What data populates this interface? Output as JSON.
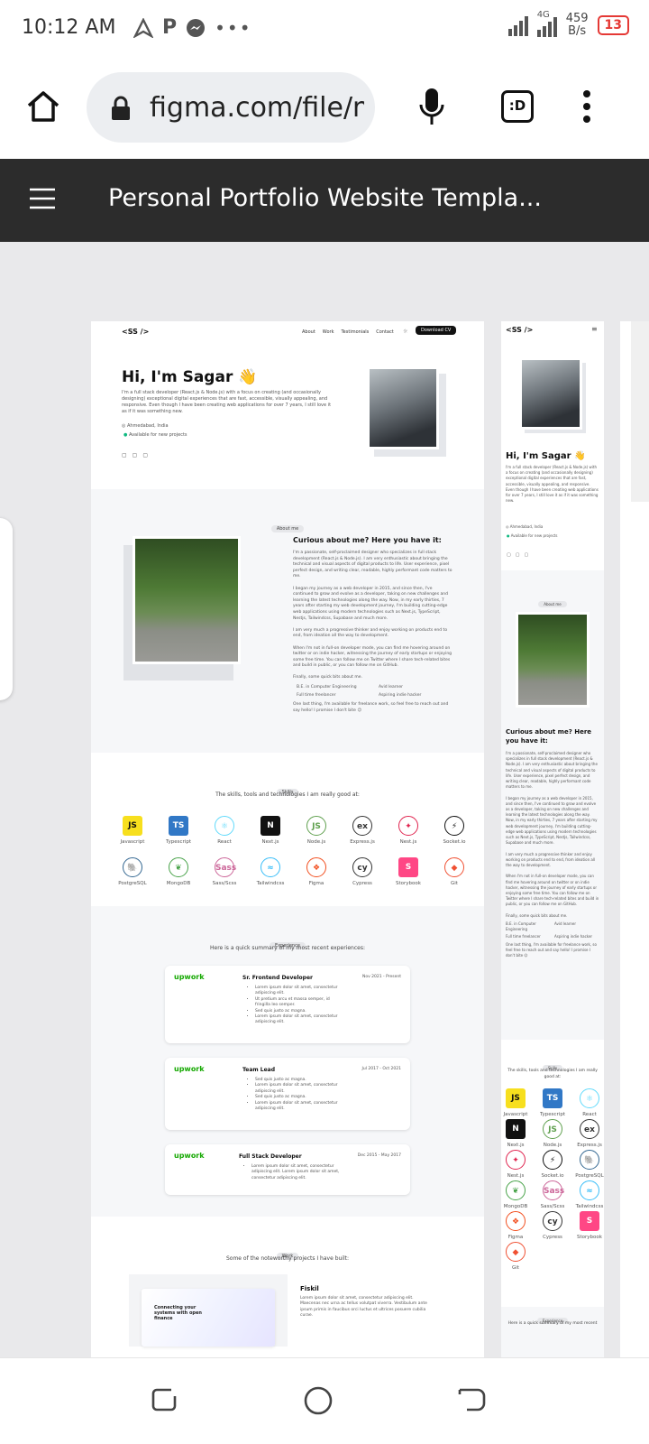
{
  "status_bar": {
    "time": "10:12 AM",
    "network": "4G",
    "speed_value": "459",
    "speed_unit": "B/s",
    "battery": "13"
  },
  "browser": {
    "url": "figma.com/file/m",
    "tab_label": ":D"
  },
  "figma": {
    "file_title": "Personal Portfolio Website Templa..."
  },
  "desktop": {
    "logo": "<SS />",
    "nav": [
      "About",
      "Work",
      "Testimonials",
      "Contact"
    ],
    "download_cv": "Download CV",
    "hero_title": "Hi, I'm Sagar 👋",
    "hero_text": "I'm a full stack developer (React.js & Node.js) with a focus on creating (and occasionally designing) exceptional digital experiences that are fast, accessible, visually appealing, and responsive. Even though I have been creating web applications for over 7 years, I still love it as if it was something new.",
    "location": "Ahmedabad, India",
    "availability": "Available for new projects",
    "about_chip": "About me",
    "about_title": "Curious about me? Here you have it:",
    "about_p1": "I'm a passionate, self-proclaimed designer who specializes in full stack development (React.js & Node.js). I am very enthusiastic about bringing the technical and visual aspects of digital products to life. User experience, pixel perfect design, and writing clear, readable, highly performant code matters to me.",
    "about_p2": "I began my journey as a web developer in 2015, and since then, I've continued to grow and evolve as a developer, taking on new challenges and learning the latest technologies along the way. Now, in my early thirties, 7 years after starting my web development journey, I'm building cutting-edge web applications using modern technologies such as Next.js, TypeScript, Nestjs, Tailwindcss, Supabase and much more.",
    "about_p3": "I am very much a progressive thinker and enjoy working on products end to end, from ideation all the way to development.",
    "about_p4": "When I'm not in full-on developer mode, you can find me hovering around on twitter or on indie hacker, witnessing the journey of early startups or enjoying some free time. You can follow me on Twitter where I share tech-related bites and build in public, or you can follow me on GitHub.",
    "about_p5": "Finally, some quick bits about me.",
    "bits": [
      "B.E. in Computer Engineering",
      "Avid learner",
      "Full time freelancer",
      "Aspiring indie hacker"
    ],
    "about_p6": "One last thing, I'm available for freelance work, so feel free to reach out and say hello! I promise I don't bite 😉",
    "skills_chip": "Skills",
    "skills_title": "The skills, tools and technologies I am really good at:",
    "skills": [
      "Javascript",
      "Typescript",
      "React",
      "Next.js",
      "Node.js",
      "Express.js",
      "Nest.js",
      "Socket.io",
      "PostgreSQL",
      "MongoDB",
      "Sass/Scss",
      "Tailwindcss",
      "Figma",
      "Cypress",
      "Storybook",
      "Git"
    ],
    "exp_chip": "Experience",
    "exp_title": "Here is a quick summary of my most recent experiences:",
    "jobs": [
      {
        "company": "upwork",
        "role": "Sr. Frontend Developer",
        "dates": "Nov 2021 - Present",
        "bullets": [
          "Lorem ipsum dolor sit amet, consectetur adipiscing elit.",
          "Ut pretium arcu et massa semper, id fringilla leo semper.",
          "Sed quis justo ac magna.",
          "Lorem ipsum dolor sit amet, consectetur adipiscing elit."
        ]
      },
      {
        "company": "upwork",
        "role": "Team Lead",
        "dates": "Jul 2017 - Oct 2021",
        "bullets": [
          "Sed quis justo ac magna.",
          "Lorem ipsum dolor sit amet, consectetur adipiscing elit.",
          "Sed quis justo ac magna.",
          "Lorem ipsum dolor sit amet, consectetur adipiscing elit."
        ]
      },
      {
        "company": "upwork",
        "role": "Full Stack Developer",
        "dates": "Dec 2015 - May 2017",
        "bullets": [
          "Lorem ipsum dolor sit amet, consectetur adipiscing elit. Lorem ipsum dolor sit amet, consectetur adipiscing elit."
        ]
      }
    ],
    "work_chip": "Work",
    "work_title": "Some of the noteworthy projects I have built:",
    "project_name": "Fiskil",
    "project_text": "Lorem ipsum dolor sit amet, consectetur adipiscing elit. Maecenas nec urna ac tellus volutpat viverra. Vestibulum ante ipsum primis in faucibus orci luctus et ultrices posuere cubilia curae.",
    "project_tagline": "Connecting your systems with open finance"
  },
  "mobile": {
    "logo": "<SS />",
    "hero_title": "Hi, I'm Sagar 👋",
    "about_chip": "About me",
    "about_title": "Curious about me? Here you have it:",
    "skills_chip": "Skills",
    "skills_title": "The skills, tools and technologies I am really good at:",
    "skills": [
      "Javascript",
      "Typescript",
      "React",
      "Next.js",
      "Node.js",
      "Express.js",
      "Nest.js",
      "Socket.io",
      "PostgreSQL",
      "MongoDB",
      "Sass/Scss",
      "Tailwindcss",
      "Figma",
      "Cypress",
      "Storybook",
      "Git"
    ],
    "exp_chip": "Experience",
    "exp_title": "Here is a quick summary of my most recent"
  },
  "icons": [
    "home-icon",
    "lock-icon",
    "mic-icon",
    "tab-switcher-icon",
    "more-vert-icon",
    "hamburger-icon",
    "recent-apps-icon",
    "home-nav-icon",
    "back-icon"
  ],
  "colors": {
    "figma_header": "#2c2c2c",
    "canvas": "#e9e9eb",
    "upwork": "#14a800",
    "battery": "#e53935"
  }
}
